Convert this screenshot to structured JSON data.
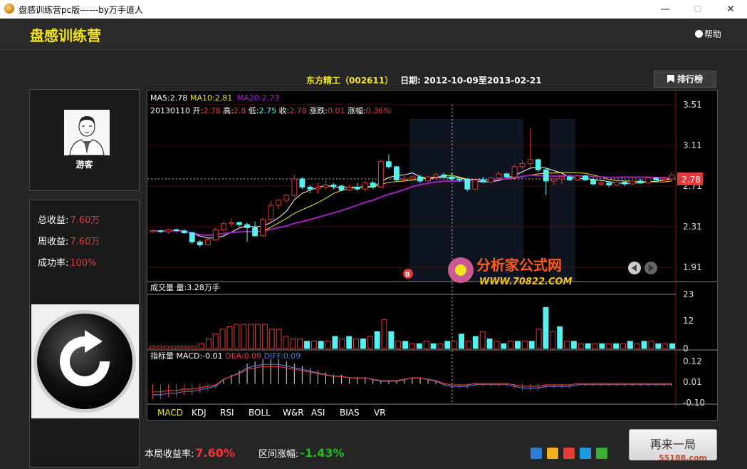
{
  "window": {
    "title": "盘感训练营pc版------by万手道人",
    "min": "—",
    "max": "☐",
    "close": "✕"
  },
  "header": {
    "logo": "盘感训练营",
    "help": "帮助"
  },
  "user": {
    "name": "游客"
  },
  "stats": {
    "total_label": "总收益:",
    "total_value": "7.60万",
    "week_label": "周收益:",
    "week_value": "7.60万",
    "rate_label": "成功率:",
    "rate_value": "100%"
  },
  "stock": {
    "name": "东方精工（002611）",
    "date_range": "日期: 2012-10-09至2013-02-21"
  },
  "rank_button": "排行榜",
  "ma_line": {
    "ma5": "MA5:2.78",
    "ma10": "MA10:2.81",
    "ma20": "MA20:2.73"
  },
  "quote": {
    "date": "20130110",
    "open_label": "开:",
    "open": "2.78",
    "high_label": "高:",
    "high": "2.8",
    "low_label": "低:",
    "low": "2.75",
    "close_label": "收:",
    "close": "2.78",
    "chg_label": "涨跌:",
    "chg": "0.01",
    "pct_label": "涨幅:",
    "pct": "0.36%"
  },
  "price_axis": [
    "3.51",
    "3.11",
    "2.71",
    "2.31",
    "1.91"
  ],
  "current_price": "2.78",
  "buy_marker": "B",
  "volume": {
    "title": "成交量 量:3.28万手",
    "axis": [
      "23",
      "12",
      "0"
    ]
  },
  "indicator": {
    "title": "指标量 MACD:-0.01",
    "dea": "DEA:0.09",
    "diff": "DIFF:0.09",
    "axis": [
      "0.12",
      "0.01",
      "-0.10"
    ]
  },
  "indicator_tabs": [
    "MACD",
    "KDJ",
    "RSI",
    "BOLL",
    "W&R",
    "ASI",
    "BIAS",
    "VR"
  ],
  "watermark_site": {
    "name": "分析家公式网",
    "url": "WWW.70822.COM"
  },
  "bottom": {
    "profit_label": "本局收益率:",
    "profit_value": "7.60%",
    "range_label": "区间涨幅:",
    "range_value": "-1.43%",
    "again": "再来一局",
    "corner_watermark": "55188.com"
  },
  "colors": {
    "up": "#e03a3a",
    "down": "#55f0f0",
    "ma5": "#ffffff",
    "ma10": "#f2e51b",
    "ma20": "#a020c0",
    "accent": "#f2e51b"
  },
  "chart_data": {
    "type": "candlestick",
    "candles": [
      [
        2.26,
        2.28,
        2.25,
        2.27
      ],
      [
        2.27,
        2.28,
        2.25,
        2.26
      ],
      [
        2.26,
        2.29,
        2.24,
        2.28
      ],
      [
        2.28,
        2.29,
        2.26,
        2.27
      ],
      [
        2.27,
        2.28,
        2.24,
        2.25
      ],
      [
        2.25,
        2.26,
        2.14,
        2.16
      ],
      [
        2.16,
        2.18,
        2.11,
        2.13
      ],
      [
        2.13,
        2.19,
        2.12,
        2.18
      ],
      [
        2.18,
        2.3,
        2.17,
        2.28
      ],
      [
        2.28,
        2.36,
        2.26,
        2.34
      ],
      [
        2.34,
        2.39,
        2.31,
        2.35
      ],
      [
        2.35,
        2.36,
        2.31,
        2.33
      ],
      [
        2.33,
        2.35,
        2.16,
        2.3
      ],
      [
        2.3,
        2.36,
        2.21,
        2.22
      ],
      [
        2.22,
        2.4,
        2.21,
        2.38
      ],
      [
        2.38,
        2.56,
        2.36,
        2.52
      ],
      [
        2.52,
        2.58,
        2.48,
        2.57
      ],
      [
        2.57,
        2.63,
        2.55,
        2.62
      ],
      [
        2.62,
        2.82,
        2.6,
        2.78
      ],
      [
        2.78,
        2.8,
        2.68,
        2.7
      ],
      [
        2.7,
        2.72,
        2.64,
        2.68
      ],
      [
        2.68,
        2.74,
        2.64,
        2.7
      ],
      [
        2.7,
        2.76,
        2.68,
        2.72
      ],
      [
        2.72,
        2.74,
        2.68,
        2.71
      ],
      [
        2.71,
        2.72,
        2.66,
        2.67
      ],
      [
        2.67,
        2.72,
        2.66,
        2.7
      ],
      [
        2.7,
        2.74,
        2.66,
        2.68
      ],
      [
        2.68,
        2.76,
        2.66,
        2.74
      ],
      [
        2.74,
        2.76,
        2.68,
        2.7
      ],
      [
        2.7,
        2.97,
        2.69,
        2.95
      ],
      [
        2.95,
        3.02,
        2.88,
        2.9
      ],
      [
        2.9,
        2.91,
        2.75,
        2.77
      ],
      [
        2.77,
        2.81,
        2.75,
        2.78
      ],
      [
        2.78,
        2.81,
        2.76,
        2.8
      ],
      [
        2.8,
        2.82,
        2.74,
        2.76
      ],
      [
        2.76,
        2.81,
        2.75,
        2.8
      ],
      [
        2.8,
        2.84,
        2.77,
        2.82
      ],
      [
        2.82,
        2.84,
        2.79,
        2.8
      ],
      [
        2.8,
        2.84,
        2.76,
        2.78
      ],
      [
        2.78,
        2.8,
        2.75,
        2.77
      ],
      [
        2.77,
        2.79,
        2.66,
        2.68
      ],
      [
        2.68,
        2.78,
        2.67,
        2.77
      ],
      [
        2.77,
        2.8,
        2.74,
        2.75
      ],
      [
        2.75,
        2.8,
        2.74,
        2.79
      ],
      [
        2.79,
        2.85,
        2.78,
        2.83
      ],
      [
        2.83,
        2.84,
        2.79,
        2.8
      ],
      [
        2.8,
        2.92,
        2.8,
        2.9
      ],
      [
        2.9,
        2.96,
        2.88,
        2.93
      ],
      [
        2.93,
        3.28,
        2.9,
        2.97
      ],
      [
        2.97,
        2.98,
        2.85,
        2.87
      ],
      [
        2.87,
        2.88,
        2.62,
        2.76
      ],
      [
        2.76,
        2.79,
        2.72,
        2.78
      ],
      [
        2.78,
        2.81,
        2.73,
        2.8
      ],
      [
        2.8,
        2.82,
        2.76,
        2.77
      ],
      [
        2.77,
        2.82,
        2.76,
        2.81
      ],
      [
        2.81,
        2.82,
        2.76,
        2.77
      ],
      [
        2.77,
        2.79,
        2.72,
        2.73
      ],
      [
        2.73,
        2.76,
        2.71,
        2.74
      ],
      [
        2.74,
        2.76,
        2.7,
        2.72
      ],
      [
        2.72,
        2.76,
        2.71,
        2.75
      ],
      [
        2.75,
        2.76,
        2.71,
        2.73
      ],
      [
        2.73,
        2.77,
        2.72,
        2.76
      ],
      [
        2.76,
        2.78,
        2.73,
        2.74
      ],
      [
        2.74,
        2.8,
        2.73,
        2.79
      ],
      [
        2.79,
        2.8,
        2.75,
        2.77
      ],
      [
        2.77,
        2.8,
        2.75,
        2.78
      ],
      [
        2.78,
        2.84,
        2.77,
        2.82
      ]
    ],
    "volume": [
      1,
      1,
      1,
      1,
      1,
      1,
      1,
      2,
      4,
      6,
      8,
      9,
      10,
      10,
      10,
      10,
      10,
      8,
      8,
      5,
      4,
      4,
      3,
      3,
      3,
      3,
      5,
      4,
      5,
      4,
      4,
      5,
      7,
      12,
      7,
      3,
      3,
      2,
      2,
      3,
      2,
      2,
      3,
      3,
      6,
      3,
      5,
      7,
      4,
      3,
      2,
      3,
      3,
      3,
      3,
      8,
      17,
      7,
      9,
      3,
      3,
      2,
      2,
      2,
      2,
      2,
      2,
      2,
      3,
      2,
      3,
      3,
      2,
      2,
      2
    ],
    "macd": [
      -0.07,
      -0.07,
      -0.06,
      -0.06,
      -0.05,
      -0.05,
      -0.04,
      -0.03,
      -0.02,
      0.02,
      0.04,
      0.06,
      0.09,
      0.1,
      0.11,
      0.11,
      0.11,
      0.1,
      0.09,
      0.08,
      0.07,
      0.06,
      0.05,
      0.04,
      0.04,
      0.03,
      0.03,
      0.03,
      0.02,
      0.01,
      0.01,
      0.01,
      0.02,
      0.03,
      0.03,
      0.02,
      0.01,
      -0.01,
      -0.02,
      -0.02,
      -0.02,
      -0.01,
      -0.01,
      -0.01,
      -0.01,
      -0.01,
      -0.02,
      -0.03,
      -0.03,
      -0.03,
      -0.02,
      -0.02,
      -0.02,
      -0.02,
      -0.01,
      -0.01,
      -0.01,
      -0.01,
      -0.01,
      -0.01,
      -0.01,
      -0.01,
      -0.01,
      -0.01,
      -0.01,
      -0.01,
      -0.01
    ],
    "price_range": [
      1.91,
      3.51
    ],
    "volume_range": [
      0,
      23
    ],
    "macd_range": [
      -0.1,
      0.12
    ]
  }
}
